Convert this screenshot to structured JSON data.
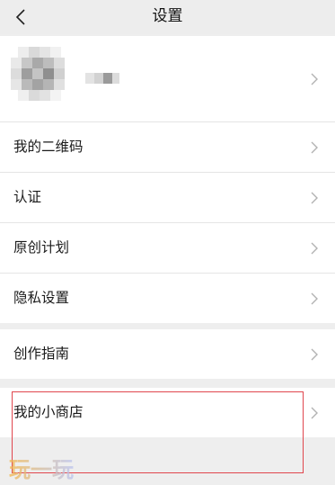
{
  "navbar": {
    "title": "设置"
  },
  "settings": {
    "items": [
      {
        "label": "我的二维码"
      },
      {
        "label": "认证"
      },
      {
        "label": "原创计划"
      },
      {
        "label": "隐私设置"
      }
    ]
  },
  "section2": {
    "items": [
      {
        "label": "创作指南"
      },
      {
        "label": "我的小商店"
      }
    ]
  },
  "watermark": {
    "text": "玩一玩"
  },
  "colors": {
    "background": "#eeeeee",
    "card": "#ffffff",
    "highlight": "#e0464d",
    "chevron": "#b2b2b2"
  },
  "icons": {
    "back": "chevron-left-icon",
    "row_arrow": "chevron-right-icon"
  }
}
